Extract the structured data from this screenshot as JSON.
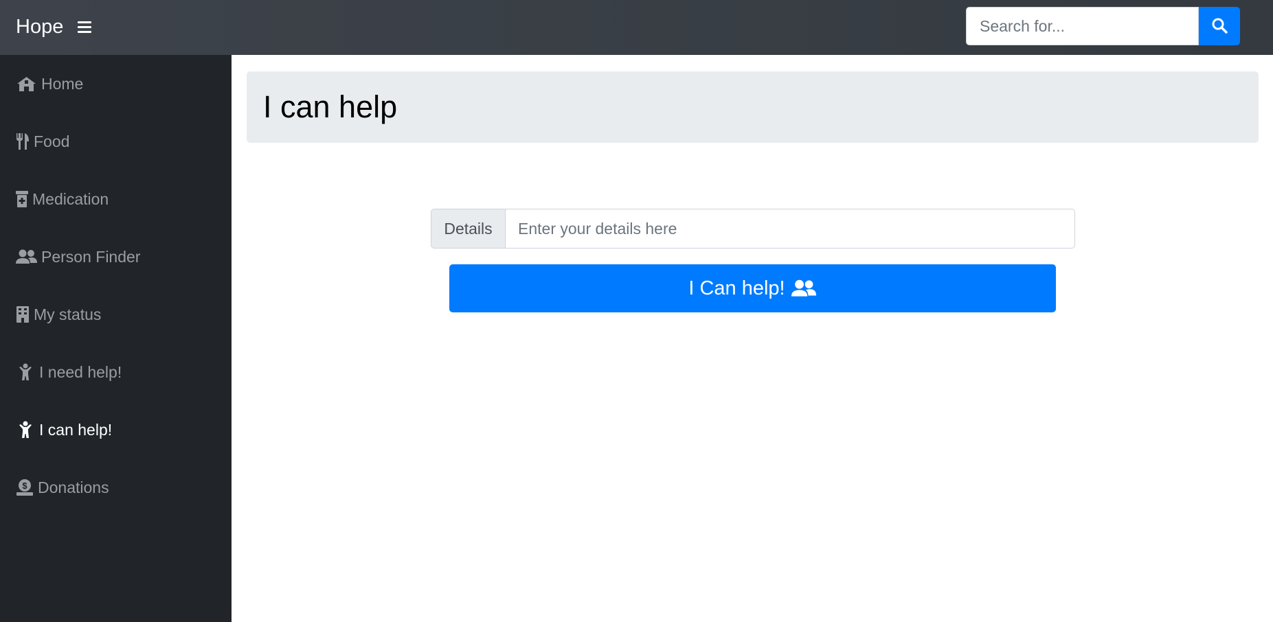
{
  "app": {
    "brand": "Hope"
  },
  "search": {
    "placeholder": "Search for..."
  },
  "sidebar": {
    "items": [
      {
        "label": "Home",
        "icon": "home-icon",
        "active": false
      },
      {
        "label": "Food",
        "icon": "utensils-icon",
        "active": false
      },
      {
        "label": "Medication",
        "icon": "prescription-bottle-icon",
        "active": false
      },
      {
        "label": "Person Finder",
        "icon": "users-icon",
        "active": false
      },
      {
        "label": "My status",
        "icon": "building-icon",
        "active": false
      },
      {
        "label": "I need help!",
        "icon": "child-icon",
        "active": false
      },
      {
        "label": "I can help!",
        "icon": "child-icon",
        "active": true
      },
      {
        "label": "Donations",
        "icon": "donate-icon",
        "active": false
      }
    ]
  },
  "main": {
    "title": "I can help",
    "details_label": "Details",
    "details_placeholder": "Enter your details here",
    "submit_label": "I Can help!"
  },
  "colors": {
    "topbar": "#343a40",
    "sidebar": "#212529",
    "primary": "#007bff",
    "jumbotron": "#e9ecef"
  }
}
